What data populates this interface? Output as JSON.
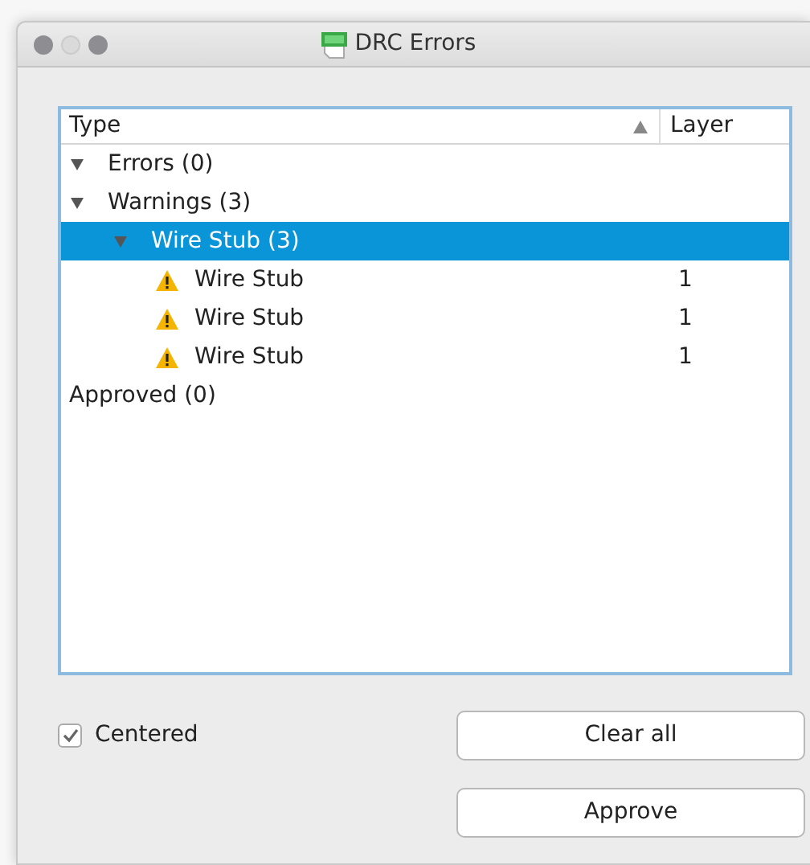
{
  "window": {
    "title": "DRC Errors"
  },
  "tree": {
    "columns": [
      {
        "label": "Type",
        "sorted": true
      },
      {
        "label": "Layer",
        "sorted": false
      }
    ],
    "items": [
      {
        "label": "Errors (0)",
        "kind": "group",
        "expanded": true,
        "selected": false
      },
      {
        "label": "Warnings (3)",
        "kind": "group",
        "expanded": true,
        "selected": false,
        "children": [
          {
            "label": "Wire Stub (3)",
            "kind": "group",
            "expanded": true,
            "selected": true,
            "children": [
              {
                "label": "Wire Stub",
                "kind": "warning",
                "layer": "1",
                "selected": false
              },
              {
                "label": "Wire Stub",
                "kind": "warning",
                "layer": "1",
                "selected": false
              },
              {
                "label": "Wire Stub",
                "kind": "warning",
                "layer": "1",
                "selected": false
              }
            ]
          }
        ]
      },
      {
        "label": "Approved (0)",
        "kind": "leaf",
        "selected": false
      }
    ]
  },
  "centered": {
    "label": "Centered",
    "checked": true
  },
  "buttons": [
    "Clear all",
    "Approve"
  ]
}
